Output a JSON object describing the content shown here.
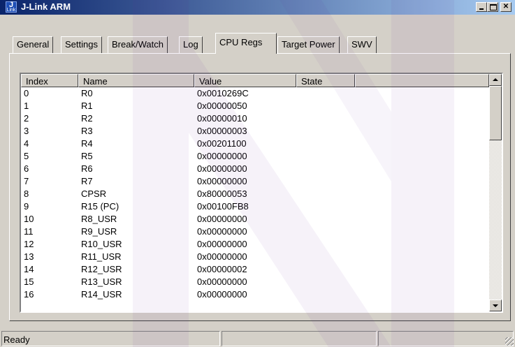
{
  "window": {
    "title": "J-Link ARM",
    "icon_top": "J",
    "icon_bottom": "Link",
    "controls": {
      "minimize": "minimize-icon",
      "maximize": "maximize-icon",
      "close": "close-icon",
      "close_glyph": "✕"
    }
  },
  "tabs": [
    {
      "label": "General",
      "active": false
    },
    {
      "label": "Settings",
      "active": false
    },
    {
      "label": "Break/Watch",
      "active": false
    },
    {
      "label": "Log",
      "active": false
    },
    {
      "label": "CPU Regs",
      "active": true
    },
    {
      "label": "Target Power",
      "active": false
    },
    {
      "label": "SWV",
      "active": false
    }
  ],
  "registers": {
    "columns": [
      "Index",
      "Name",
      "Value",
      "State"
    ],
    "rows": [
      {
        "index": "0",
        "name": "R0",
        "value": "0x0010269C",
        "state": ""
      },
      {
        "index": "1",
        "name": "R1",
        "value": "0x00000050",
        "state": ""
      },
      {
        "index": "2",
        "name": "R2",
        "value": "0x00000010",
        "state": ""
      },
      {
        "index": "3",
        "name": "R3",
        "value": "0x00000003",
        "state": ""
      },
      {
        "index": "4",
        "name": "R4",
        "value": "0x00201100",
        "state": ""
      },
      {
        "index": "5",
        "name": "R5",
        "value": "0x00000000",
        "state": ""
      },
      {
        "index": "6",
        "name": "R6",
        "value": "0x00000000",
        "state": ""
      },
      {
        "index": "7",
        "name": "R7",
        "value": "0x00000000",
        "state": ""
      },
      {
        "index": "8",
        "name": "CPSR",
        "value": "0x80000053",
        "state": ""
      },
      {
        "index": "9",
        "name": "R15 (PC)",
        "value": "0x00100FB8",
        "state": ""
      },
      {
        "index": "10",
        "name": "R8_USR",
        "value": "0x00000000",
        "state": ""
      },
      {
        "index": "11",
        "name": "R9_USR",
        "value": "0x00000000",
        "state": ""
      },
      {
        "index": "12",
        "name": "R10_USR",
        "value": "0x00000000",
        "state": ""
      },
      {
        "index": "13",
        "name": "R11_USR",
        "value": "0x00000000",
        "state": ""
      },
      {
        "index": "14",
        "name": "R12_USR",
        "value": "0x00000002",
        "state": ""
      },
      {
        "index": "15",
        "name": "R13_USR",
        "value": "0x00000000",
        "state": ""
      },
      {
        "index": "16",
        "name": "R14_USR",
        "value": "0x00000000",
        "state": ""
      }
    ]
  },
  "status": {
    "text": "Ready"
  },
  "colors": {
    "titlebar_start": "#0a246a",
    "titlebar_end": "#a6caf0",
    "face": "#d4d0c8",
    "watermark": "#6a1fa0"
  }
}
